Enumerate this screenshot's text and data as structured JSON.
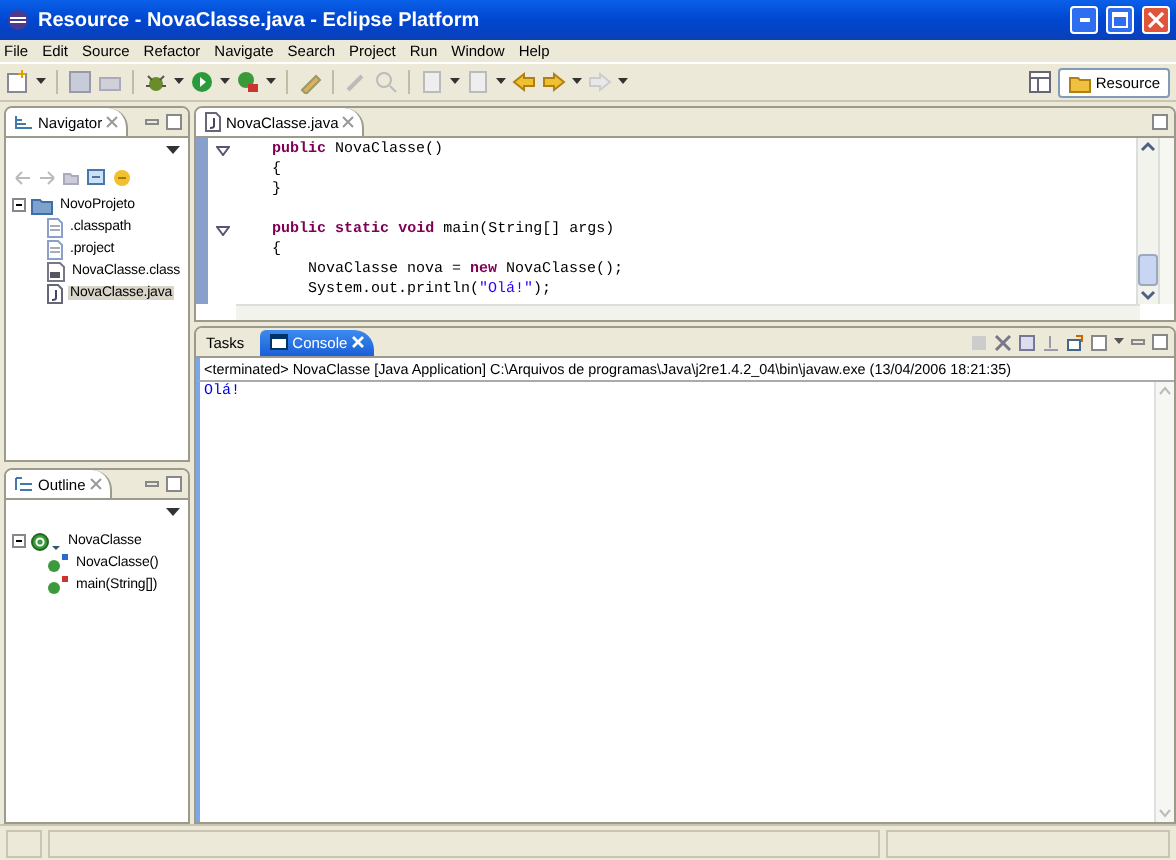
{
  "window": {
    "title": "Resource - NovaClasse.java - Eclipse Platform"
  },
  "menu": [
    "File",
    "Edit",
    "Source",
    "Refactor",
    "Navigate",
    "Search",
    "Project",
    "Run",
    "Window",
    "Help"
  ],
  "perspective": {
    "label": "Resource",
    "selected": true
  },
  "navigator": {
    "title": "Navigator",
    "tree": [
      {
        "label": "NovoProjeto",
        "kind": "project",
        "selected": false,
        "expanded": true,
        "children": [
          {
            "label": ".classpath",
            "kind": "file",
            "selected": false
          },
          {
            "label": ".project",
            "kind": "file",
            "selected": false
          },
          {
            "label": "NovaClasse.class",
            "kind": "class",
            "selected": false
          },
          {
            "label": "NovaClasse.java",
            "kind": "java",
            "selected": true
          }
        ]
      }
    ]
  },
  "outline": {
    "title": "Outline",
    "tree": [
      {
        "label": "NovaClasse",
        "kind": "type",
        "selected": false,
        "expanded": true,
        "children": [
          {
            "label": "NovaClasse()",
            "kind": "constructor",
            "selected": false
          },
          {
            "label": "main(String[])",
            "kind": "static",
            "selected": false
          }
        ]
      }
    ]
  },
  "editor": {
    "tab": "NovaClasse.java",
    "lines": [
      {
        "kind": "fold",
        "text": "    **public** NovaClasse()"
      },
      {
        "kind": "code",
        "text": "    {"
      },
      {
        "kind": "code",
        "text": "    }"
      },
      {
        "kind": "blank"
      },
      {
        "kind": "fold",
        "text": "    **public** **static** **void** main(String[] args)"
      },
      {
        "kind": "code",
        "text": "    {"
      },
      {
        "kind": "code",
        "text": "        NovaClasse nova = **new** NovaClasse();"
      },
      {
        "kind": "code",
        "text": "        System.out.println(*\"Olá!\"*);"
      }
    ]
  },
  "console": {
    "tabs": [
      {
        "label": "Tasks",
        "selected": false
      },
      {
        "label": "Console",
        "selected": true
      }
    ],
    "header": "<terminated> NovaClasse [Java Application] C:\\Arquivos de programas\\Java\\j2re1.4.2_04\\bin\\javaw.exe (13/04/2006 18:21:35)",
    "output": [
      "Olá!"
    ]
  }
}
